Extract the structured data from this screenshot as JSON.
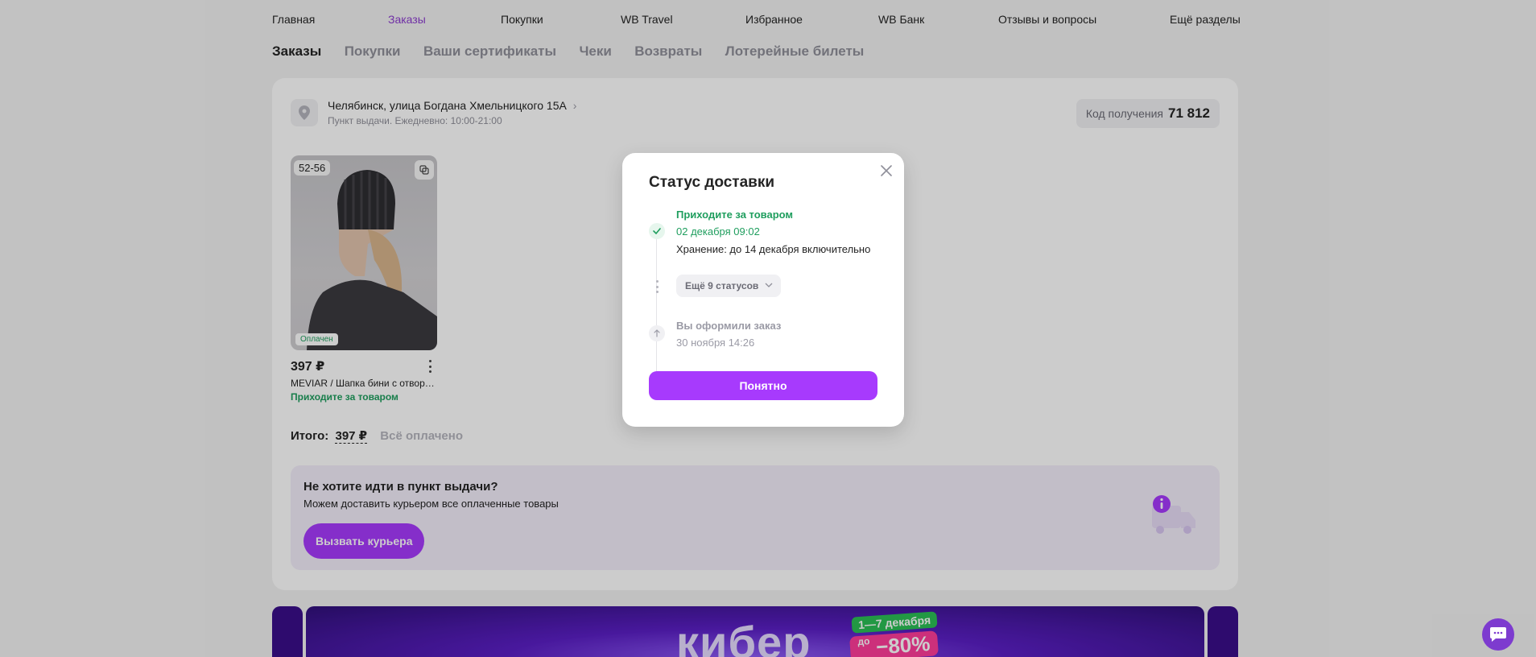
{
  "nav": {
    "items": [
      {
        "label": "Главная"
      },
      {
        "label": "Заказы"
      },
      {
        "label": "Покупки"
      },
      {
        "label": "WB Travel"
      },
      {
        "label": "Избранное"
      },
      {
        "label": "WB Банк"
      },
      {
        "label": "Отзывы и вопросы"
      },
      {
        "label": "Ещё разделы"
      }
    ],
    "active": "Заказы"
  },
  "tabs": [
    {
      "label": "Заказы"
    },
    {
      "label": "Покупки"
    },
    {
      "label": "Ваши сертификаты"
    },
    {
      "label": "Чеки"
    },
    {
      "label": "Возвраты"
    },
    {
      "label": "Лотерейные билеты"
    }
  ],
  "order": {
    "address": "Челябинск, улица Богдана Хмельницкого 15А",
    "pickup_info": "Пункт выдачи. Ежедневно: 10:00-21:00",
    "code_label": "Код получения",
    "code_value": "71 812",
    "product": {
      "size": "52-56",
      "paid_badge": "Оплачен",
      "price": "397 ₽",
      "name": "MEVIAR / Шапка бини с отворо...",
      "status": "Приходите за товаром"
    },
    "total_label": "Итого:",
    "total_value": "397 ₽",
    "total_status": "Всё оплачено"
  },
  "courier": {
    "title": "Не хотите идти в пункт выдачи?",
    "subtitle": "Можем доставить курьером все оплаченные товары",
    "button": "Вызвать курьера"
  },
  "banner": {
    "word": "кибер",
    "dates": "1—7 декабря",
    "discount_prefix": "до",
    "discount": "−80%"
  },
  "modal": {
    "title": "Статус доставки",
    "step1": {
      "title": "Приходите за товаром",
      "date": "02 декабря 09:02",
      "extra": "Хранение: до 14 декабря включительно"
    },
    "more_statuses": "Ещё 9 статусов",
    "step2": {
      "title": "Вы оформили заказ",
      "date": "30 ноября 14:26"
    },
    "ok_button": "Понятно"
  },
  "colors": {
    "accent": "#a73afd",
    "nav_active": "#8c3ccf",
    "success": "#1f9e5e"
  }
}
